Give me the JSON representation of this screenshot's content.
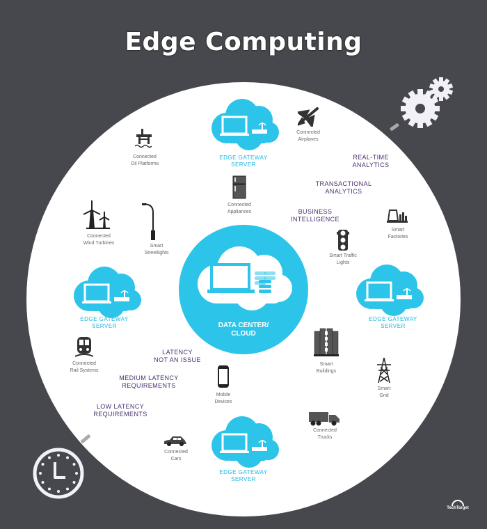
{
  "title": "Edge Computing",
  "colors": {
    "background": "#46484d",
    "circle": "#ffffff",
    "cloud": "#2dc4ea",
    "tier_text": "#4a2f6e",
    "device_text": "#666666"
  },
  "center": {
    "label_line1": "DATA CENTER/",
    "label_line2": "CLOUD",
    "icons": [
      "laptop-icon",
      "database-icon"
    ]
  },
  "gateways": [
    {
      "position": "top",
      "line1": "EDGE GATEWAY",
      "line2": "SERVER"
    },
    {
      "position": "left",
      "line1": "EDGE GATEWAY",
      "line2": "SERVER"
    },
    {
      "position": "right",
      "line1": "EDGE GATEWAY",
      "line2": "SERVER"
    },
    {
      "position": "bottom",
      "line1": "EDGE GATEWAY",
      "line2": "SERVER"
    }
  ],
  "tiers": {
    "upper": [
      {
        "line1": "REAL-TIME",
        "line2": "ANALYTICS"
      },
      {
        "line1": "TRANSACTIONAL",
        "line2": "ANALYTICS"
      },
      {
        "line1": "BUSINESS",
        "line2": "INTELLIGENCE"
      }
    ],
    "lower": [
      {
        "line1": "LATENCY",
        "line2": "NOT AN ISSUE"
      },
      {
        "line1": "MEDIUM LATENCY",
        "line2": "REQUIREMENTS"
      },
      {
        "line1": "LOW LATENCY",
        "line2": "REQUIREMENTS"
      }
    ]
  },
  "devices": [
    {
      "icon": "oil-platform-icon",
      "line1": "Connected",
      "line2": "Oil Platforms"
    },
    {
      "icon": "airplane-icon",
      "line1": "Connected",
      "line2": "Airplanes"
    },
    {
      "icon": "appliance-icon",
      "line1": "Connected",
      "line2": "Appliances"
    },
    {
      "icon": "factory-icon",
      "line1": "Smart",
      "line2": "Factories"
    },
    {
      "icon": "wind-turbine-icon",
      "line1": "Connected",
      "line2": "Wind Turbines"
    },
    {
      "icon": "streetlight-icon",
      "line1": "Smart",
      "line2": "Streetlights"
    },
    {
      "icon": "traffic-light-icon",
      "line1": "Smart Traffic",
      "line2": "Lights"
    },
    {
      "icon": "train-icon",
      "line1": "Connected",
      "line2": "Rail Systems"
    },
    {
      "icon": "building-icon",
      "line1": "Smart",
      "line2": "Buildings"
    },
    {
      "icon": "power-tower-icon",
      "line1": "Smart",
      "line2": "Grid"
    },
    {
      "icon": "mobile-icon",
      "line1": "Mobile",
      "line2": "Devices"
    },
    {
      "icon": "truck-icon",
      "line1": "Connected",
      "line2": "Trucks"
    },
    {
      "icon": "car-icon",
      "line1": "Connected",
      "line2": "Cars"
    }
  ],
  "logo": "TechTarget"
}
